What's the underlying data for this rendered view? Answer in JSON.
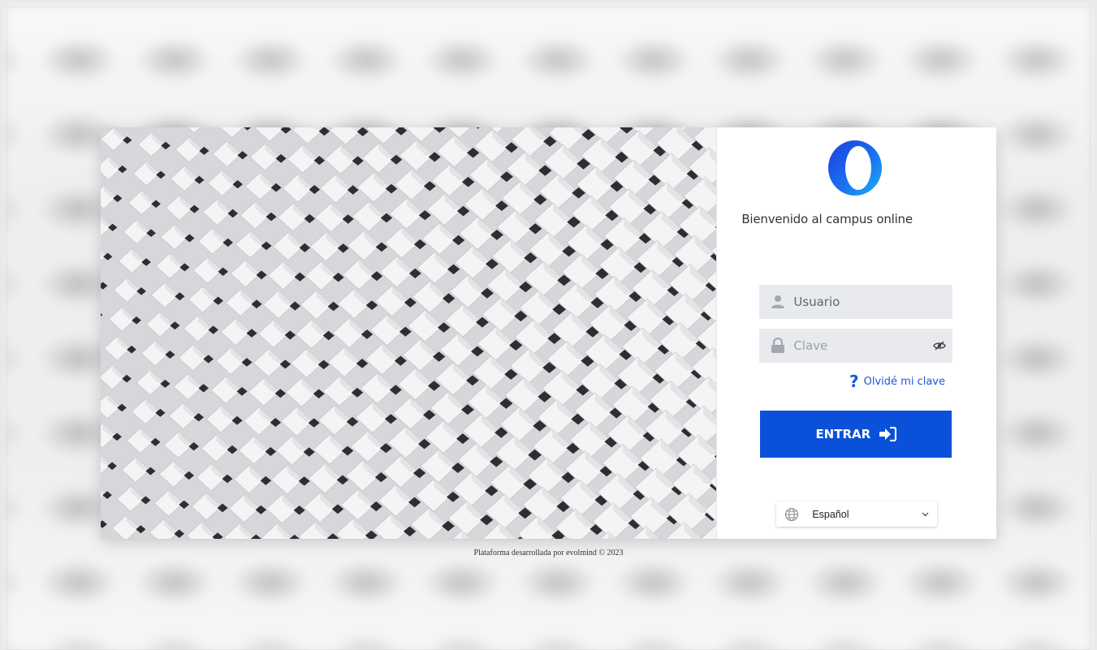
{
  "login": {
    "welcome": "Bienvenido al campus online",
    "username_placeholder": "Usuario",
    "password_placeholder": "Clave",
    "forgot_label": "Olvidé mi clave",
    "submit_label": "ENTRAR",
    "language_selected": "Español"
  },
  "footer": {
    "text": "Plataforma desarrollada por evolmind © 2023"
  },
  "icons": {
    "logo": "evolmind-ring-logo",
    "user": "user-icon",
    "lock": "lock-icon",
    "eye": "eye-slash-icon",
    "help": "question-icon",
    "enter": "sign-in-icon",
    "globe": "globe-icon",
    "chevron": "chevron-down-icon"
  },
  "colors": {
    "primary": "#0b50d8",
    "link": "#1a56db",
    "field_bg": "#e8eaee"
  }
}
